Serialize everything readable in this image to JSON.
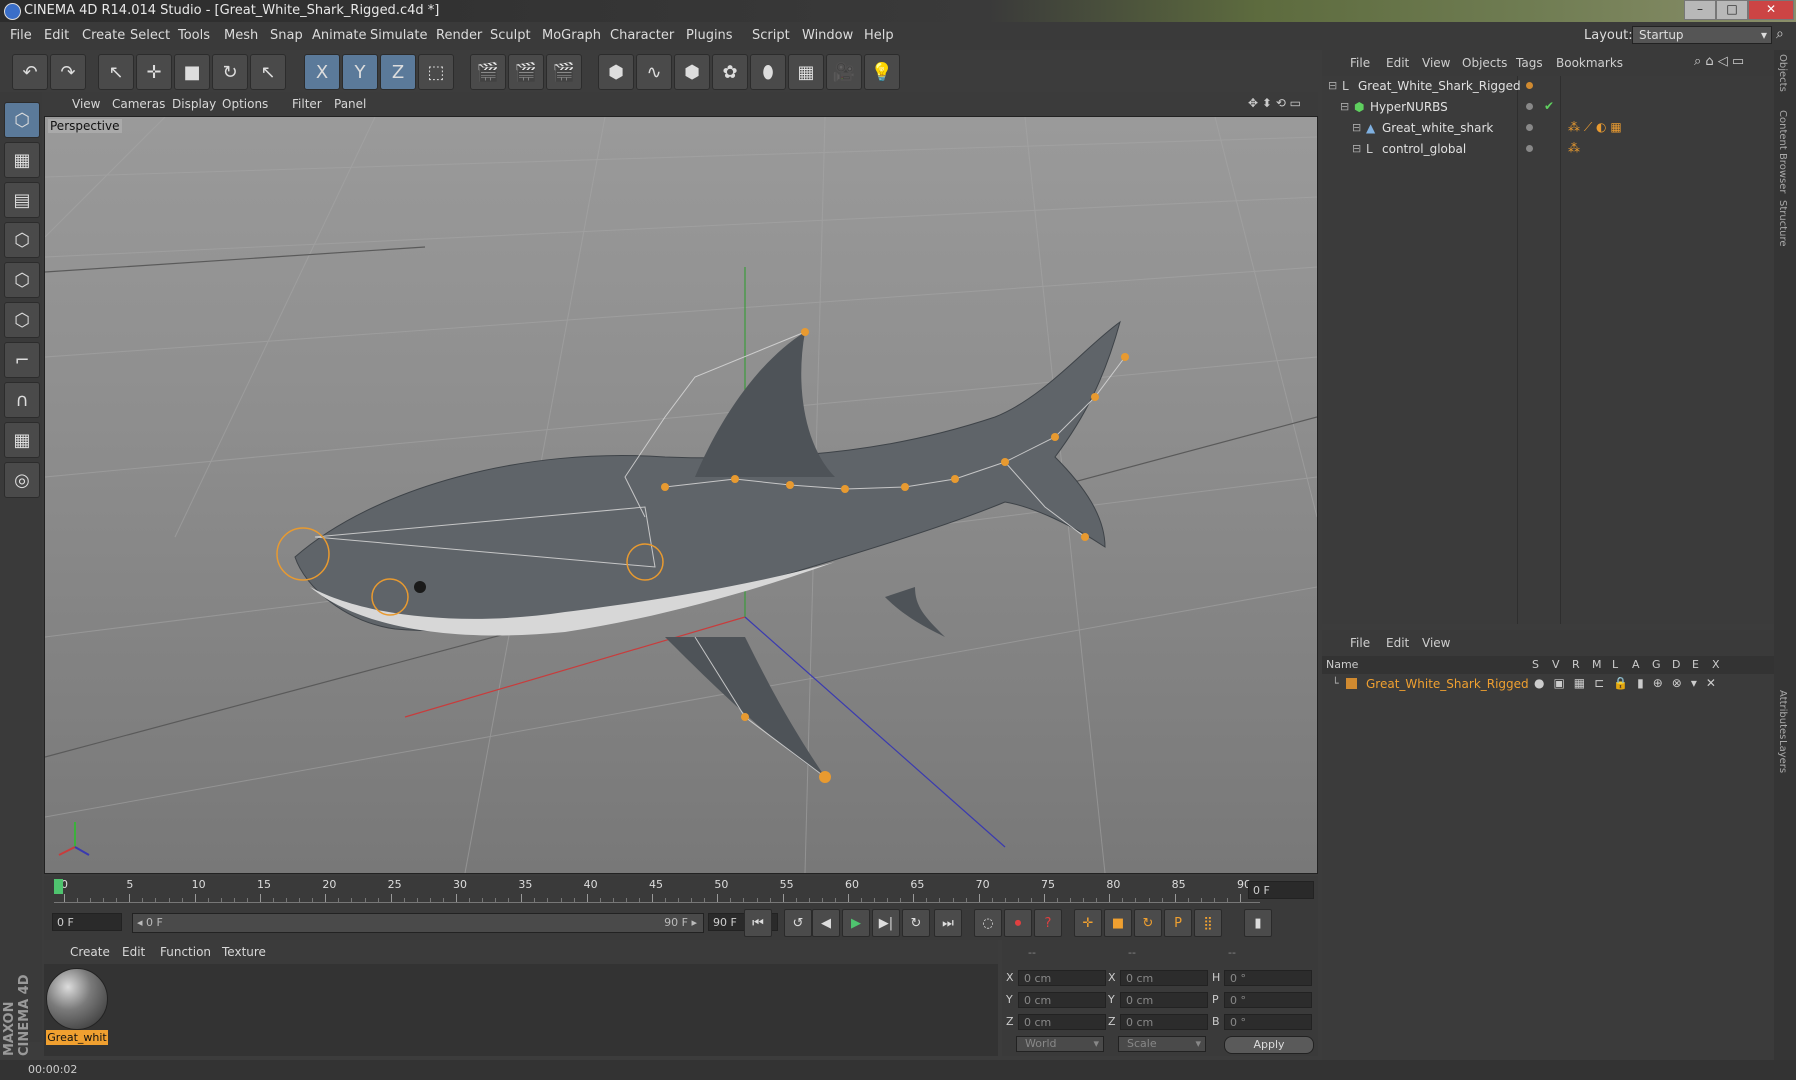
{
  "window": {
    "title": "CINEMA 4D R14.014 Studio - [Great_White_Shark_Rigged.c4d *]",
    "layout_label": "Layout:",
    "layout_value": "Startup",
    "minimize": "–",
    "maximize": "□",
    "close": "✕"
  },
  "menu": [
    "File",
    "Edit",
    "Create",
    "Select",
    "Tools",
    "Mesh",
    "Snap",
    "Animate",
    "Simulate",
    "Render",
    "Sculpt",
    "MoGraph",
    "Character",
    "Plugins",
    "Script",
    "Window",
    "Help"
  ],
  "toolbar_icons": [
    "undo-icon",
    "redo-icon",
    "select-live-icon",
    "move-icon",
    "scale-icon",
    "rotate-icon",
    "select-recent-icon",
    "x-axis-icon",
    "y-axis-icon",
    "z-axis-icon",
    "coordinate-system-icon",
    "render-view-icon",
    "render-picture-viewer-icon",
    "render-settings-icon",
    "cube-icon",
    "spline-icon",
    "nurbs-icon",
    "array-icon",
    "deformer-icon",
    "floor-icon",
    "camera-icon",
    "light-icon"
  ],
  "toolbar_glyphs": [
    "↶",
    "↷",
    "↖",
    "✛",
    "■",
    "↻",
    "↖",
    "X",
    "Y",
    "Z",
    "⬚",
    "🎬",
    "🎬",
    "🎬",
    "⬢",
    "∿",
    "⬢",
    "✿",
    "⬮",
    "▦",
    "🎥",
    "💡"
  ],
  "left_icons": [
    "model-mode-icon",
    "texture-mode-icon",
    "workplane-mode-icon",
    "points-mode-icon",
    "edges-mode-icon",
    "polygons-mode-icon",
    "axis-mode-icon",
    "magnet-icon",
    "grid-snap-icon",
    "lock-workplane-icon"
  ],
  "left_glyphs": [
    "⬡",
    "▦",
    "▤",
    "⬡",
    "⬡",
    "⬡",
    "⌐",
    "∩",
    "▦",
    "◎"
  ],
  "viewport": {
    "menu": [
      "View",
      "Cameras",
      "Display",
      "Options",
      "Filter",
      "Panel"
    ],
    "label": "Perspective"
  },
  "timeline": {
    "ticks": [
      "0",
      "5",
      "10",
      "15",
      "20",
      "25",
      "30",
      "35",
      "40",
      "45",
      "50",
      "55",
      "60",
      "65",
      "70",
      "75",
      "80",
      "85",
      "90"
    ],
    "current_frame": "0 F",
    "start_field": "0 F",
    "range_start": "◂ 0 F",
    "range_end": "90 F ▸",
    "end_field": "90 F"
  },
  "playback_icons": [
    "go-to-start-icon",
    "previous-key-icon",
    "play-backward-icon",
    "play-forward-icon",
    "next-key-icon",
    "loop-icon",
    "go-to-end-icon",
    "autokey-icon",
    "record-icon",
    "help-icon",
    "move-key-icon",
    "scale-key-icon",
    "rotate-key-icon",
    "param-key-icon",
    "pla-key-icon",
    "timeline-icon"
  ],
  "playback_glyphs": [
    "⏮",
    "↺",
    "◀",
    "▶",
    "▶|",
    "↻",
    "⏭",
    "◌",
    "⏺",
    "?",
    "✛",
    "■",
    "↻",
    "P",
    "⣿",
    "▮"
  ],
  "materials": {
    "menu": [
      "Create",
      "Edit",
      "Function",
      "Texture"
    ],
    "items": [
      {
        "name": "Great_whit"
      }
    ]
  },
  "coordinates": {
    "header": [
      "--",
      "--",
      "--"
    ],
    "rows": [
      {
        "a": "X",
        "v1": "0 cm",
        "b": "X",
        "v2": "0 cm",
        "c": "H",
        "v3": "0 °"
      },
      {
        "a": "Y",
        "v1": "0 cm",
        "b": "Y",
        "v2": "0 cm",
        "c": "P",
        "v3": "0 °"
      },
      {
        "a": "Z",
        "v1": "0 cm",
        "b": "Z",
        "v2": "0 cm",
        "c": "B",
        "v3": "0 °"
      }
    ],
    "mode": "World",
    "transform": "Scale",
    "apply": "Apply"
  },
  "objects": {
    "menu": [
      "File",
      "Edit",
      "View",
      "Objects",
      "Tags",
      "Bookmarks"
    ],
    "tree": [
      {
        "name": "Great_White_Shark_Rigged",
        "indent": 0
      },
      {
        "name": "HyperNURBS",
        "indent": 1
      },
      {
        "name": "Great_white_shark",
        "indent": 2
      },
      {
        "name": "control_global",
        "indent": 2
      }
    ]
  },
  "layers": {
    "menu": [
      "File",
      "Edit",
      "View"
    ],
    "columns": [
      "Name",
      "S",
      "V",
      "R",
      "M",
      "L",
      "A",
      "G",
      "D",
      "E",
      "X"
    ],
    "rows": [
      {
        "name": "Great_White_Shark_Rigged"
      }
    ]
  },
  "side_tabs": [
    "Objects",
    "Content Browser",
    "Structure",
    "Attributes",
    "Layers"
  ],
  "brand": "MAXON CINEMA 4D",
  "status": "00:00:02",
  "colors": {
    "accent": "#f0a030",
    "bg": "#3c3c3c",
    "selection": "#e8a030"
  }
}
